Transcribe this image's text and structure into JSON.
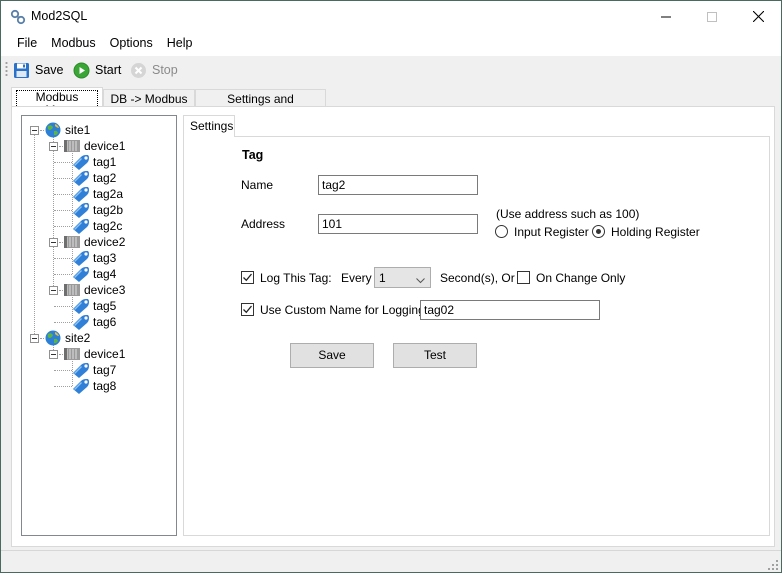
{
  "window": {
    "title": "Mod2SQL",
    "controls": {
      "minimize": "minimize",
      "maximize": "maximize",
      "close": "close"
    }
  },
  "menu": {
    "items": [
      "File",
      "Modbus",
      "Options",
      "Help"
    ]
  },
  "toolbar": {
    "save_label": "Save",
    "start_label": "Start",
    "stop_label": "Stop",
    "stop_enabled": false
  },
  "tabs": [
    {
      "label": "Modbus Map",
      "active": true
    },
    {
      "label": "DB -> Modbus",
      "active": false
    },
    {
      "label": "Settings and Diagnostics",
      "active": false
    }
  ],
  "tree": {
    "nodes": [
      {
        "label": "site1",
        "type": "site",
        "level": 0,
        "expanded": true
      },
      {
        "label": "device1",
        "type": "device",
        "level": 1,
        "expanded": true
      },
      {
        "label": "tag1",
        "type": "tag",
        "level": 2
      },
      {
        "label": "tag2",
        "type": "tag",
        "level": 2
      },
      {
        "label": "tag2a",
        "type": "tag",
        "level": 2
      },
      {
        "label": "tag2b",
        "type": "tag",
        "level": 2
      },
      {
        "label": "tag2c",
        "type": "tag",
        "level": 2
      },
      {
        "label": "device2",
        "type": "device",
        "level": 1,
        "expanded": true
      },
      {
        "label": "tag3",
        "type": "tag",
        "level": 2
      },
      {
        "label": "tag4",
        "type": "tag",
        "level": 2
      },
      {
        "label": "device3",
        "type": "device",
        "level": 1,
        "expanded": true
      },
      {
        "label": "tag5",
        "type": "tag",
        "level": 2
      },
      {
        "label": "tag6",
        "type": "tag",
        "level": 2
      },
      {
        "label": "site2",
        "type": "site",
        "level": 0,
        "expanded": true
      },
      {
        "label": "device1",
        "type": "device",
        "level": 1,
        "expanded": true
      },
      {
        "label": "tag7",
        "type": "tag",
        "level": 2
      },
      {
        "label": "tag8",
        "type": "tag",
        "level": 2
      }
    ]
  },
  "settings": {
    "tab_label": "Settings",
    "section_title": "Tag",
    "name_label": "Name",
    "name_value": "tag2",
    "address_label": "Address",
    "address_value": "101",
    "address_hint": "(Use address such as 100)",
    "input_register_label": "Input Register",
    "input_register_checked": false,
    "holding_register_label": "Holding Register",
    "holding_register_checked": true,
    "log_label": "Log This Tag:",
    "log_checked": true,
    "every_label": "Every",
    "every_value": "1",
    "seconds_label": "Second(s), Or",
    "on_change_label": "On Change Only",
    "on_change_checked": false,
    "custom_name_label": "Use Custom Name for Logging:",
    "custom_name_checked": true,
    "custom_name_value": "tag02",
    "save_button": "Save",
    "test_button": "Test"
  },
  "colors": {
    "tag_icon": "#2f80d6",
    "start_icon": "#3aa635",
    "save_icon": "#2a72c9"
  }
}
